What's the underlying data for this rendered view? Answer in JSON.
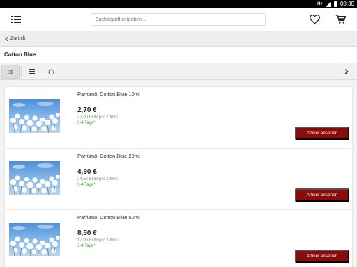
{
  "statusbar": {
    "network": "H+",
    "time": "08:30"
  },
  "search": {
    "placeholder": "Suchbegriff eingeben ..."
  },
  "nav": {
    "back_label": "Zurück"
  },
  "page": {
    "title": "Cotton Blue"
  },
  "toolbar": {
    "views": [
      "list-view-icon",
      "grid-view-icon",
      "loading-spinner-icon"
    ],
    "next_icon": "chevron-right-icon"
  },
  "icons": {
    "menu": "hamburger-menu-icon",
    "wishlist": "heart-icon",
    "cart": "cart-icon"
  },
  "colors": {
    "button": "#8b0a0a",
    "delivery": "#3da53d"
  },
  "products": [
    {
      "name": "Parfümöl Cotton Blue 10ml",
      "price": "2,70 €",
      "unit_price": "27,00 EUR pro 100ml",
      "delivery": "3-4 Tage*",
      "button": "Artikel ansehen"
    },
    {
      "name": "Parfümöl Cotton Blue 20ml",
      "price": "4,90 €",
      "unit_price": "24,50 EUR pro 100ml",
      "delivery": "3-4 Tage*",
      "button": "Artikel ansehen"
    },
    {
      "name": "Parfümöl Cotton Blue 50ml",
      "price": "8,50 €",
      "unit_price": "17,00 EUR pro 100ml",
      "delivery": "3-4 Tage*",
      "button": "Artikel ansehen"
    }
  ]
}
